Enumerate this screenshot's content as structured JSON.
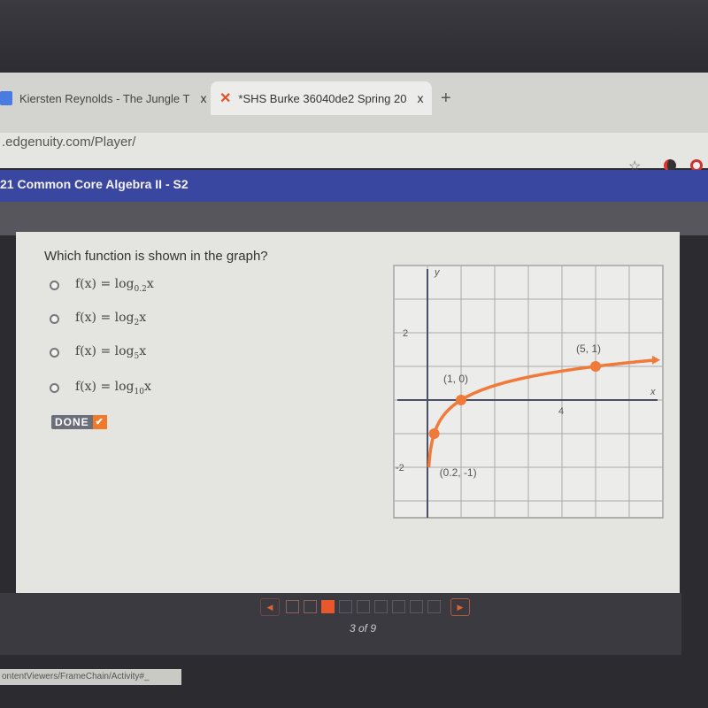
{
  "browser": {
    "tabs": [
      {
        "label": "Kiersten Reynolds - The Jungle T",
        "close": "x"
      },
      {
        "label": "*SHS Burke 36040de2 Spring 20",
        "close": "x"
      }
    ],
    "new_tab": "+",
    "url": ".edgenuity.com/Player/",
    "status_url": "ontentViewers/FrameChain/Activity#_"
  },
  "header": {
    "course": "21 Common Core Algebra II - S2"
  },
  "question": {
    "prompt": "Which function is shown in the graph?",
    "options": [
      {
        "prefix": "f(x) = log",
        "base": "0.2",
        "suffix": "x"
      },
      {
        "prefix": "f(x) = log",
        "base": "2",
        "suffix": "x"
      },
      {
        "prefix": "f(x) = log",
        "base": "5",
        "suffix": "x"
      },
      {
        "prefix": "f(x) = log",
        "base": "10",
        "suffix": "x"
      }
    ],
    "done_label": "DONE",
    "done_icon": "checkmark-icon"
  },
  "graph": {
    "x_label": "x",
    "y_label": "y",
    "x_ticks": [
      "4"
    ],
    "y_ticks": [
      "2",
      "-2"
    ],
    "xlim": [
      -1,
      7
    ],
    "ylim": [
      -3.5,
      4
    ],
    "curve_color": "#f07a3a",
    "points": [
      {
        "x": 0.2,
        "y": -1,
        "label": "(0.2, -1)"
      },
      {
        "x": 1,
        "y": 0,
        "label": "(1, 0)"
      },
      {
        "x": 5,
        "y": 1,
        "label": "(5, 1)"
      }
    ]
  },
  "pager": {
    "current": 3,
    "total": 9,
    "label": "3 of 9",
    "prev": "◀",
    "next": "▶",
    "accent": "#e8582a"
  }
}
